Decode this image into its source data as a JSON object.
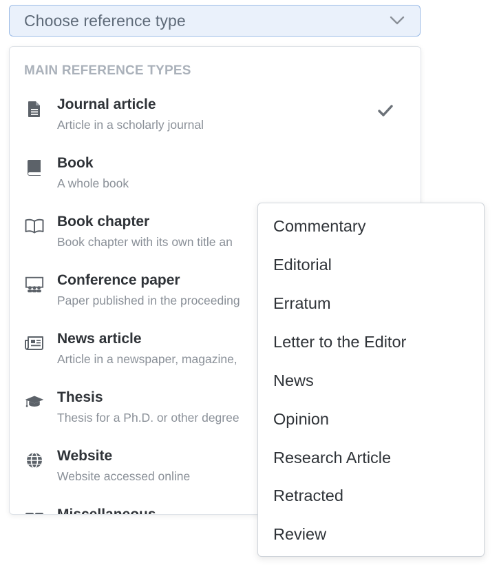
{
  "select": {
    "placeholder": "Choose reference type",
    "chevron_icon": "chevron-down-icon"
  },
  "dropdown": {
    "group_header": "MAIN REFERENCE TYPES",
    "items": [
      {
        "title": "Journal article",
        "description": "Article in a scholarly journal",
        "icon": "document-icon",
        "selected": true
      },
      {
        "title": "Book",
        "description": "A whole book",
        "icon": "book-icon",
        "selected": false
      },
      {
        "title": "Book chapter",
        "description": "Book chapter with its own title an",
        "icon": "open-book-icon",
        "selected": false
      },
      {
        "title": "Conference paper",
        "description": "Paper published in the proceeding",
        "icon": "conference-icon",
        "selected": false
      },
      {
        "title": "News article",
        "description": "Article in a newspaper, magazine,",
        "icon": "newspaper-icon",
        "selected": false
      },
      {
        "title": "Thesis",
        "description": "Thesis for a Ph.D. or other degree",
        "icon": "graduation-cap-icon",
        "selected": false
      },
      {
        "title": "Website",
        "description": "Website accessed online",
        "icon": "globe-icon",
        "selected": false
      },
      {
        "title": "Miscellaneous",
        "description": "",
        "icon": "misc-icon",
        "selected": false
      }
    ]
  },
  "subtypes": {
    "items": [
      "Commentary",
      "Editorial",
      "Erratum",
      "Letter to the Editor",
      "News",
      "Opinion",
      "Research Article",
      "Retracted",
      "Review"
    ]
  },
  "colors": {
    "trigger_bg": "#eaf1fb",
    "trigger_border": "#9bbbe6",
    "icon_gray": "#5c6269",
    "text_dark": "#2f3338",
    "text_muted": "#8a9098",
    "header_gray": "#aab1ba"
  }
}
